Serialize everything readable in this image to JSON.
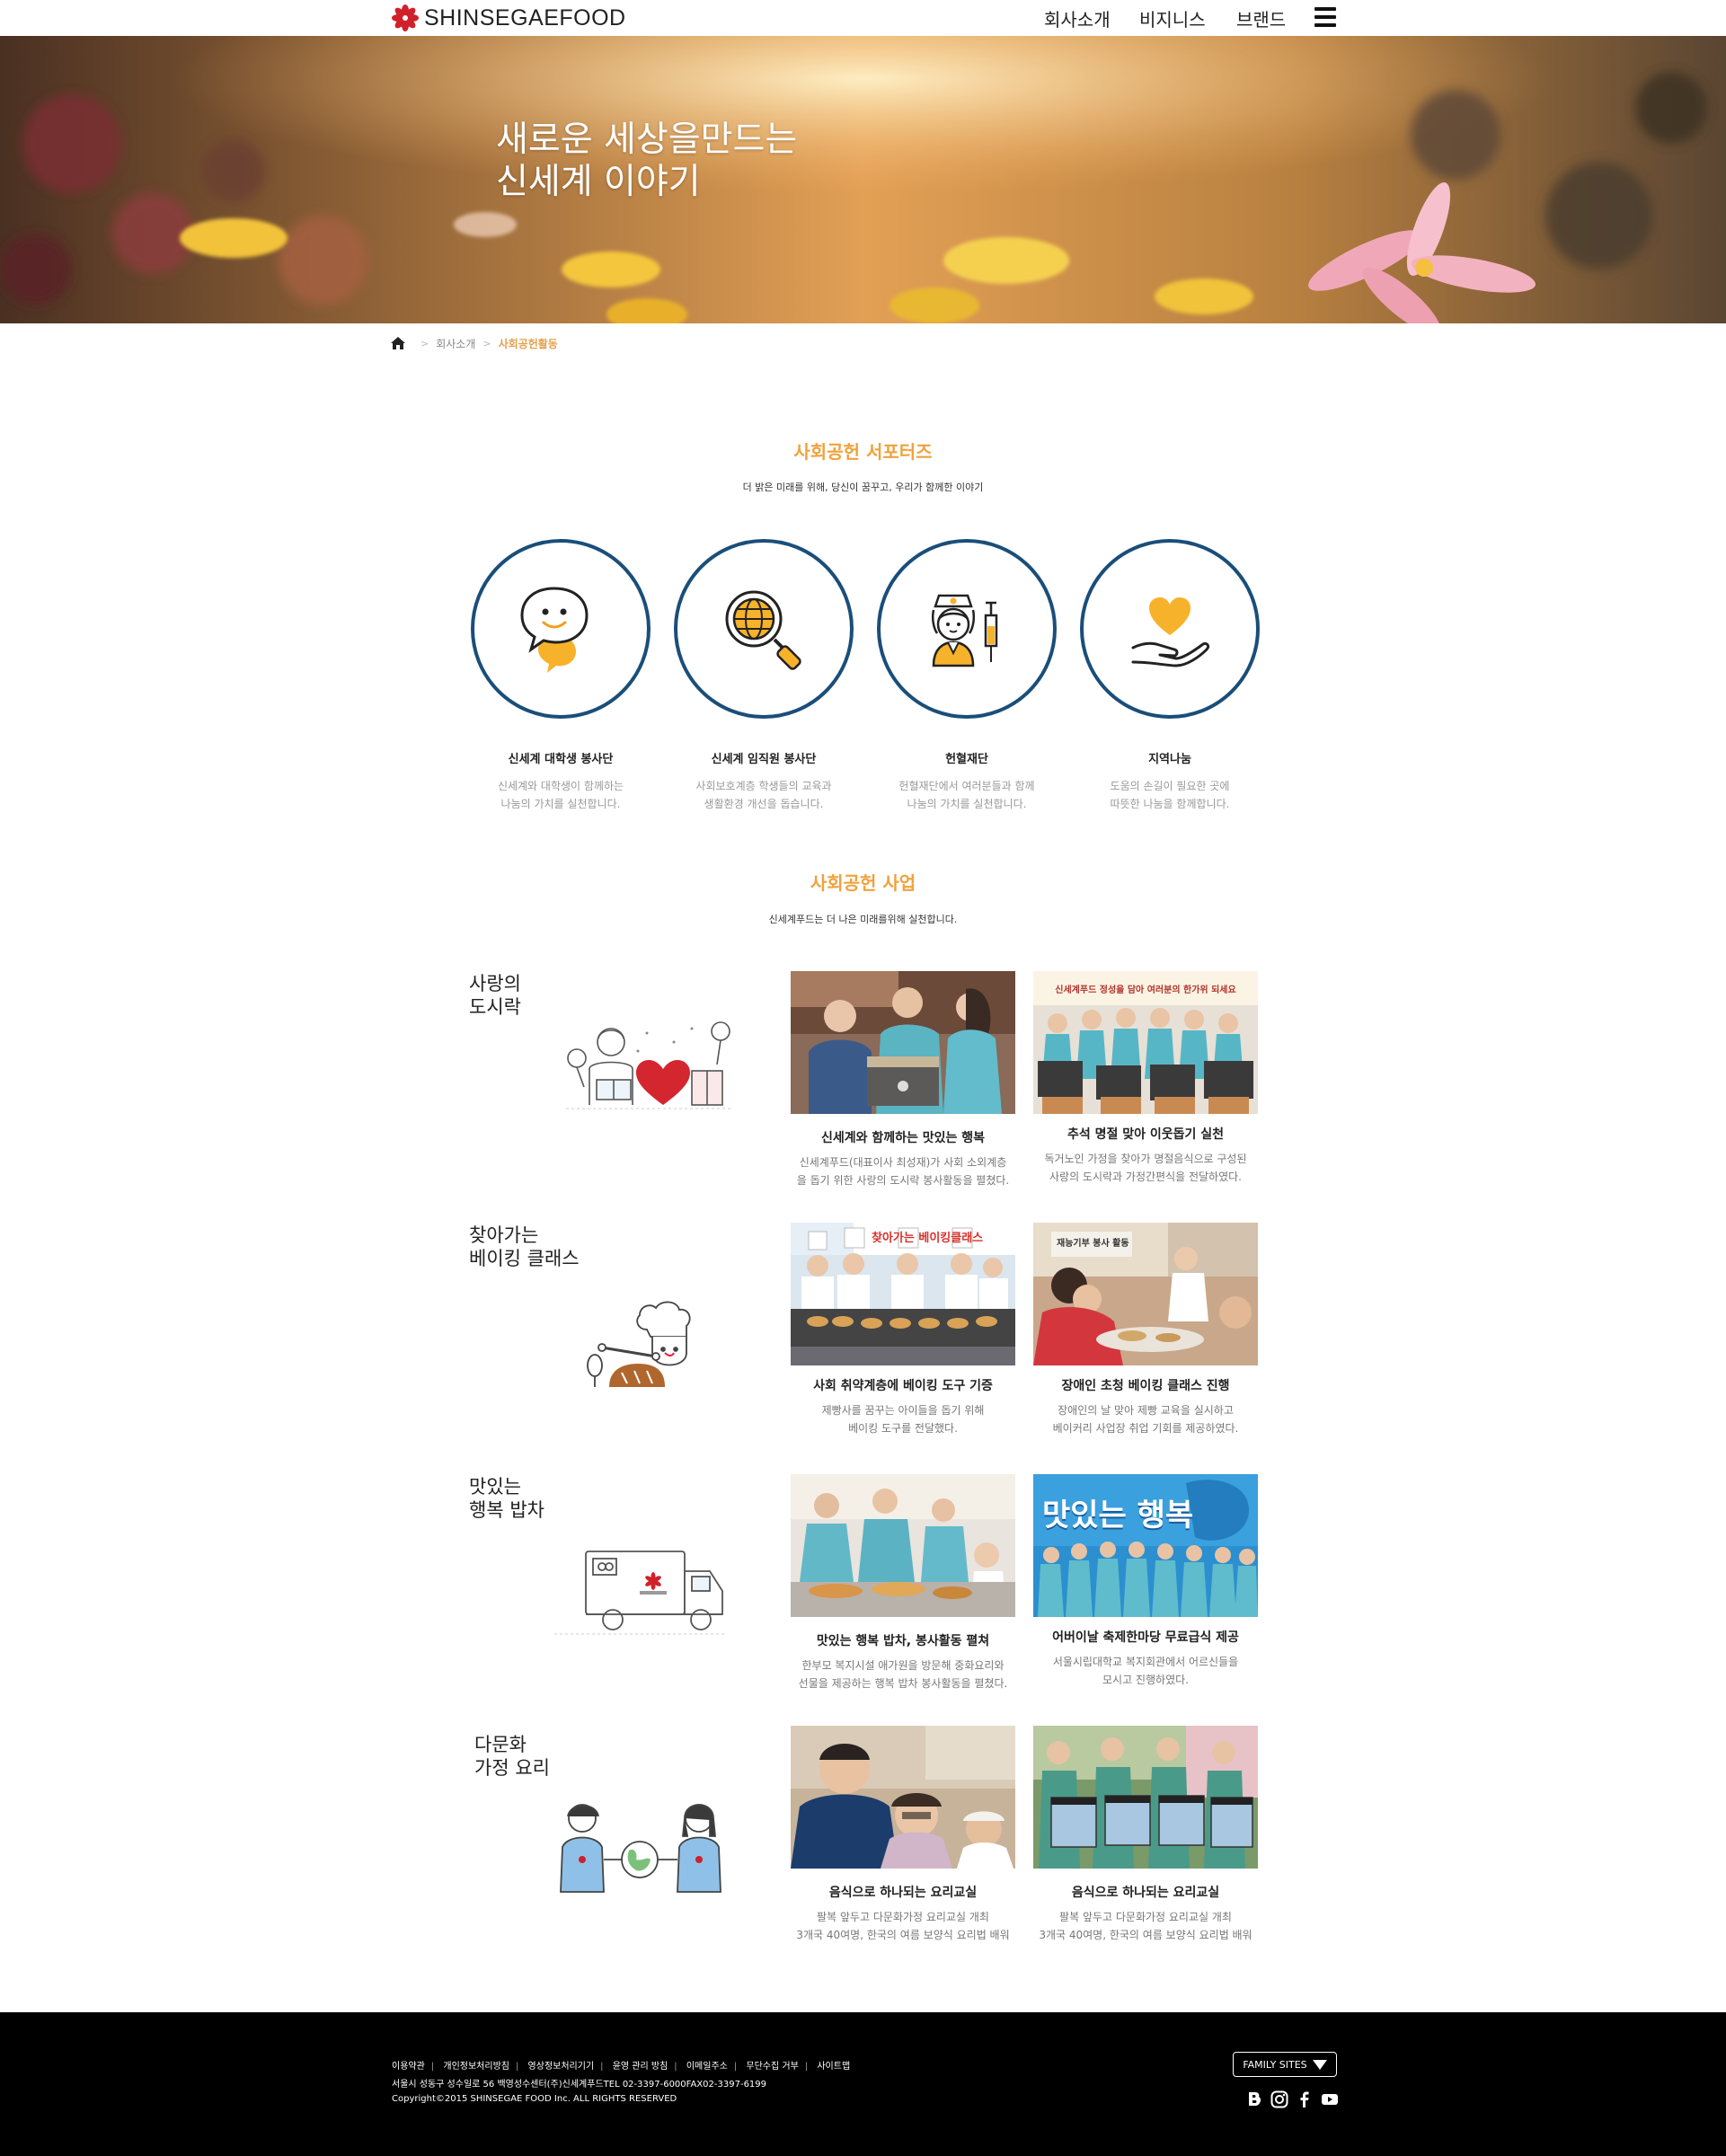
{
  "header": {
    "logo_text": "SHINSEGAEFOOD",
    "nav": [
      "회사소개",
      "비지니스",
      "브랜드"
    ]
  },
  "hero": {
    "line1": "새로운 세상을만드는",
    "line2": "신세계 이야기"
  },
  "breadcrumb": {
    "parent": "회사소개",
    "current": "사회공헌활동"
  },
  "supporters": {
    "title": "사회공헌 서포터즈",
    "subtitle": "더 밝은 미래를 위해, 당신이 꿈꾸고, 우리가 함께한 이야기",
    "items": [
      {
        "title": "신세계 대학생 봉사단",
        "desc1": "신세계와 대학생이 함께하는",
        "desc2": "나눔의 가치를 실천합니다.",
        "icon": "chat-bubbles-icon"
      },
      {
        "title": "신세계 임직원 봉사단",
        "desc1": "사회보호계층 학생들의 교육과",
        "desc2": "생활환경 개선을 돕습니다.",
        "icon": "globe-magnifier-icon"
      },
      {
        "title": "헌혈재단",
        "desc1": "헌혈재단에서 여러분들과 함께",
        "desc2": "나눔의 가치를 실천합니다.",
        "icon": "nurse-syringe-icon"
      },
      {
        "title": "지역나눔",
        "desc1": "도움의 손길이 필요한 곳에",
        "desc2": "따뜻한 나눔을 함께합니다.",
        "icon": "heart-hand-icon"
      }
    ]
  },
  "business": {
    "title": "사회공헌 사업",
    "subtitle": "신세계푸드는 더 나은 미래를위해 실천합니다.",
    "rows": [
      {
        "title1": "사랑의",
        "title2": "도시락",
        "illus": "lunchbox-heart-icon",
        "cards": [
          {
            "title": "신세계와 함께하는 맛있는 행복",
            "desc1": "신세계푸드(대표이사 최성재)가 사회 소외계층",
            "desc2": "을 돕기 위한 사랑의 도시락 봉사활동을 펼쳤다."
          },
          {
            "title": "추석 명절 맞아 이웃돕기 실천",
            "desc1": "독거노인 가정을 찾아가 명절음식으로 구성된",
            "desc2": "사랑의 도시락과 가정간편식을 전달하였다.",
            "banner": "신세계푸드 정성을 담아 여러분의 한가위 되세요"
          }
        ]
      },
      {
        "title1": "찾아가는",
        "title2": "베이킹 클래스",
        "illus": "chef-baking-icon",
        "cards": [
          {
            "title": "사회 취약계층에 베이킹 도구 기증",
            "desc1": "제빵사를 꿈꾸는 아이들을 돕기 위해",
            "desc2": "베이킹 도구를 전달했다.",
            "banner": "찾아가는 베이킹클래스"
          },
          {
            "title": "장애인 초청 베이킹 클래스 진행",
            "desc1": "장애인의 날 맞아 제빵 교육을 실시하고",
            "desc2": "베이커리 사업장 취업 기회를 제공하였다.",
            "banner": "재능기부 봉사 활동"
          }
        ]
      },
      {
        "title1": "맛있는",
        "title2": "행복 밥차",
        "illus": "food-truck-icon",
        "cards": [
          {
            "title": "맛있는 행복 밥차, 봉사활동 펼쳐",
            "desc1": "한부모 복지시설 애가원을 방문해 중화요리와",
            "desc2": "선물을 제공하는 행복 밥차 봉사활동을 펼쳤다."
          },
          {
            "title": "어버이날 축제한마당 무료급식 제공",
            "desc1": "서울시립대학교 복지회관에서 어르신들을",
            "desc2": "모시고 진행하였다.",
            "banner": "맛있는 행복"
          }
        ]
      },
      {
        "title1": "다문화",
        "title2": "가정 요리",
        "illus": "multicultural-family-icon",
        "cards": [
          {
            "title": "음식으로 하나되는 요리교실",
            "desc1": "팔복 앞두고 다문화가정 요리교실 개최",
            "desc2": "3개국 40여명, 한국의 여름 보양식 요리법 배워"
          },
          {
            "title": "음식으로 하나되는 요리교실",
            "desc1": "팔복 앞두고 다문화가정 요리교실 개최",
            "desc2": "3개국 40여명, 한국의 여름 보양식 요리법 배워"
          }
        ]
      }
    ]
  },
  "footer": {
    "links": [
      "이용약관",
      "개인정보처리방침",
      "영상정보처리기기",
      "윤영 관리 방침",
      "이메일주소",
      "무단수집 거부",
      "사이트맵"
    ],
    "address": "서울시 성동구 성수일로 56 백영성수센터(주)신세계푸드TEL 02-3397-6000FAX02-3397-6199",
    "copyright": "Copyright©2015 SHINSEGAE FOOD Inc. ALL RIGHTS RESERVED",
    "family_sites": "FAMILY SITES"
  },
  "colors": {
    "accent": "#f0a23c",
    "circle_border": "#1a4e7a",
    "footer_bg": "#000000"
  }
}
